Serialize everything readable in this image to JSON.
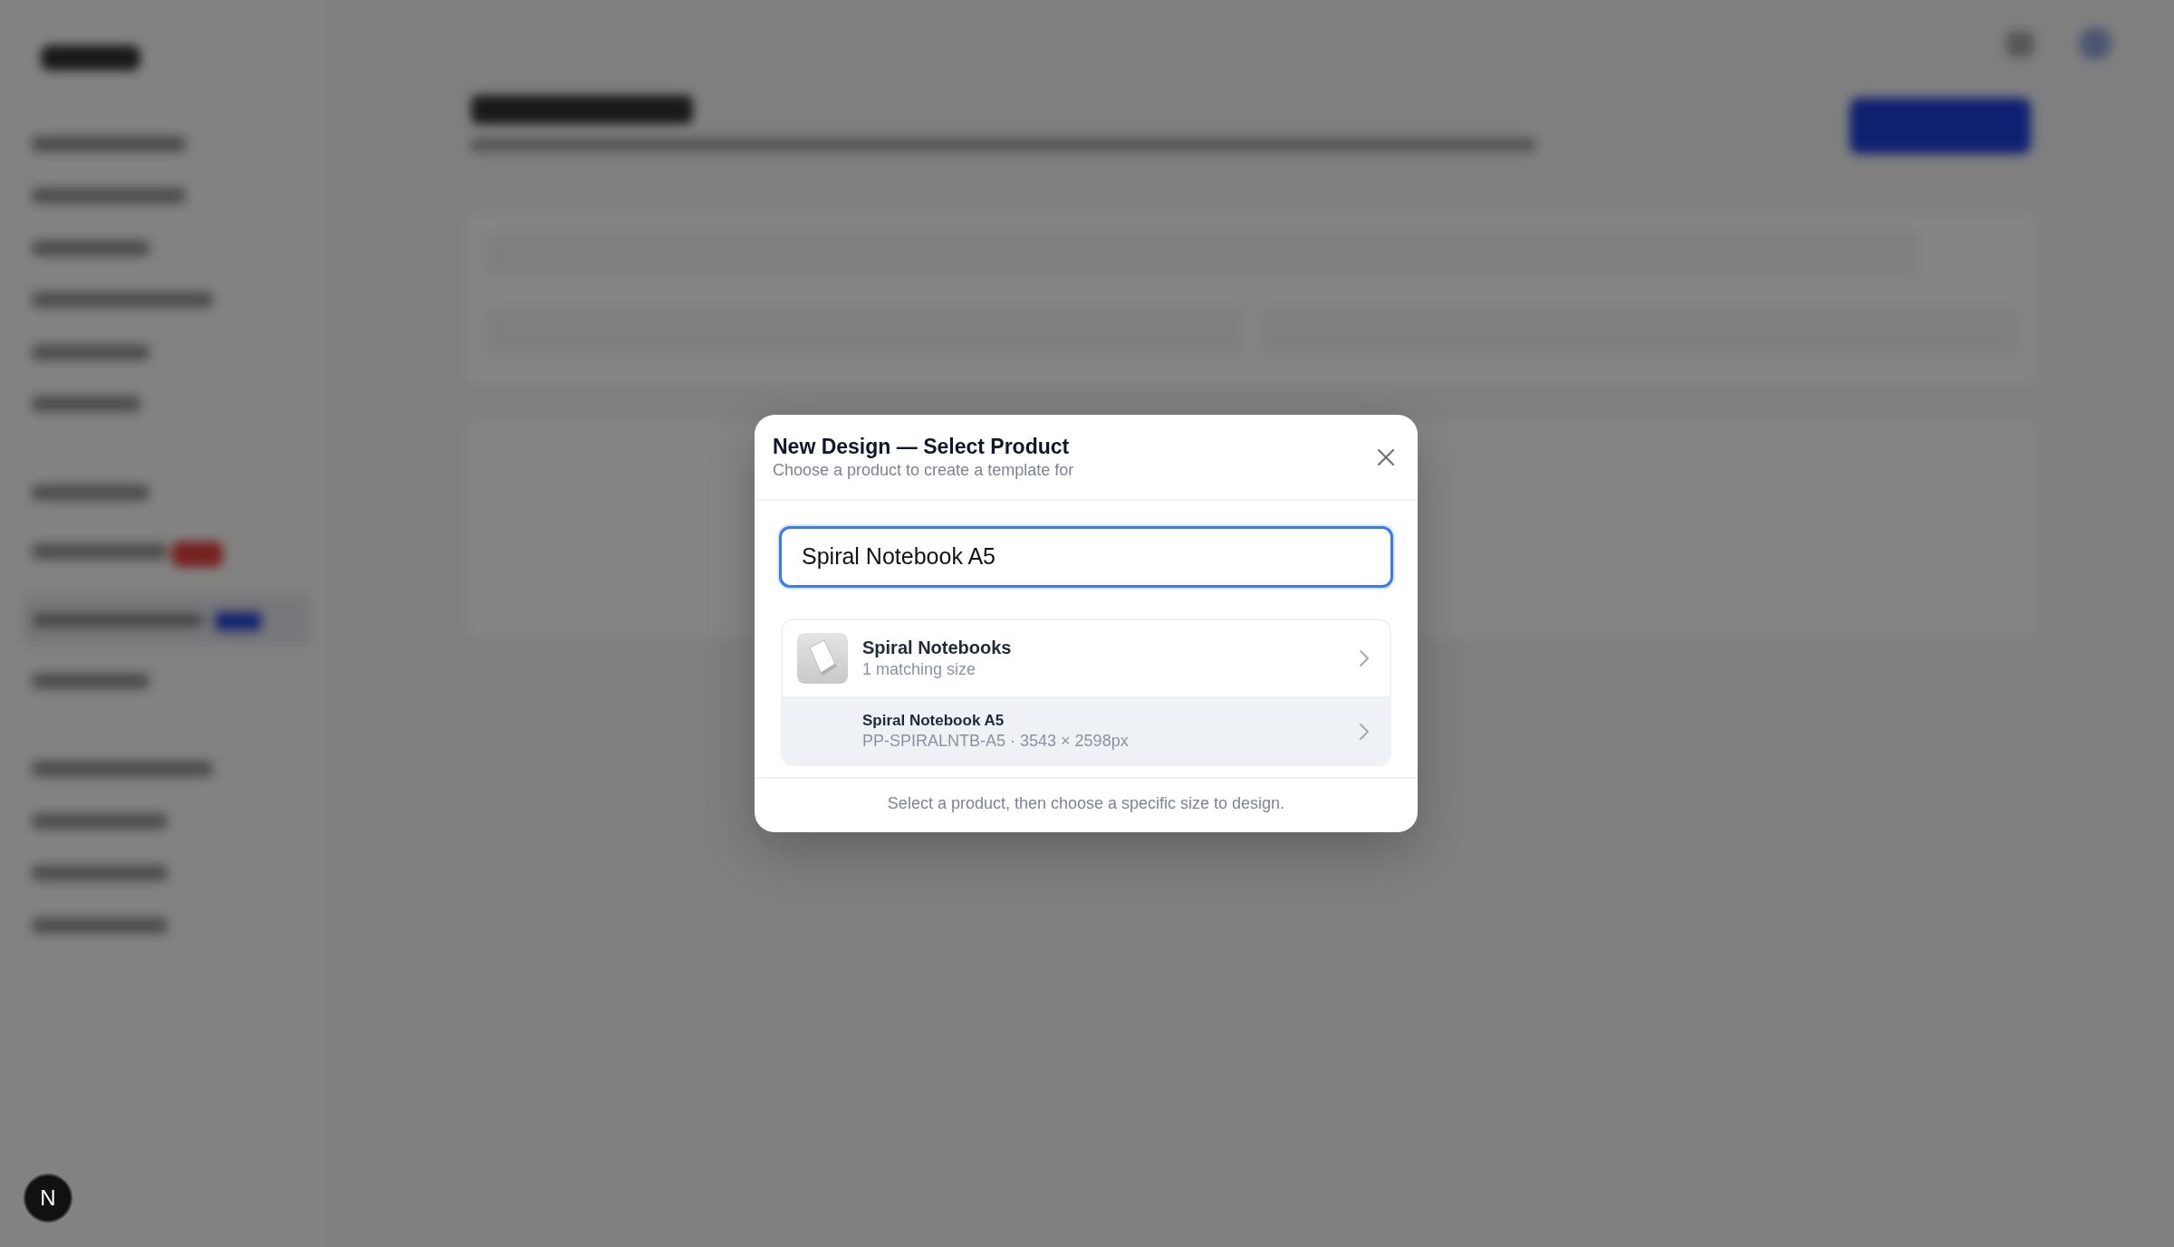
{
  "modal": {
    "title": "New Design — Select Product",
    "subtitle": "Choose a product to create a template for",
    "search": {
      "value": "Spiral Notebook A5"
    },
    "results": [
      {
        "kind": "product",
        "name": "Spiral Notebooks",
        "detail": "1 matching size",
        "highlighted": false
      },
      {
        "kind": "size",
        "name": "Spiral Notebook A5",
        "detail": "PP-SPIRALNTB-A5 · 3543 × 2598px",
        "highlighted": true
      }
    ],
    "footer": "Select a product, then choose a specific size to design."
  },
  "dev_badge": {
    "label": "N"
  }
}
